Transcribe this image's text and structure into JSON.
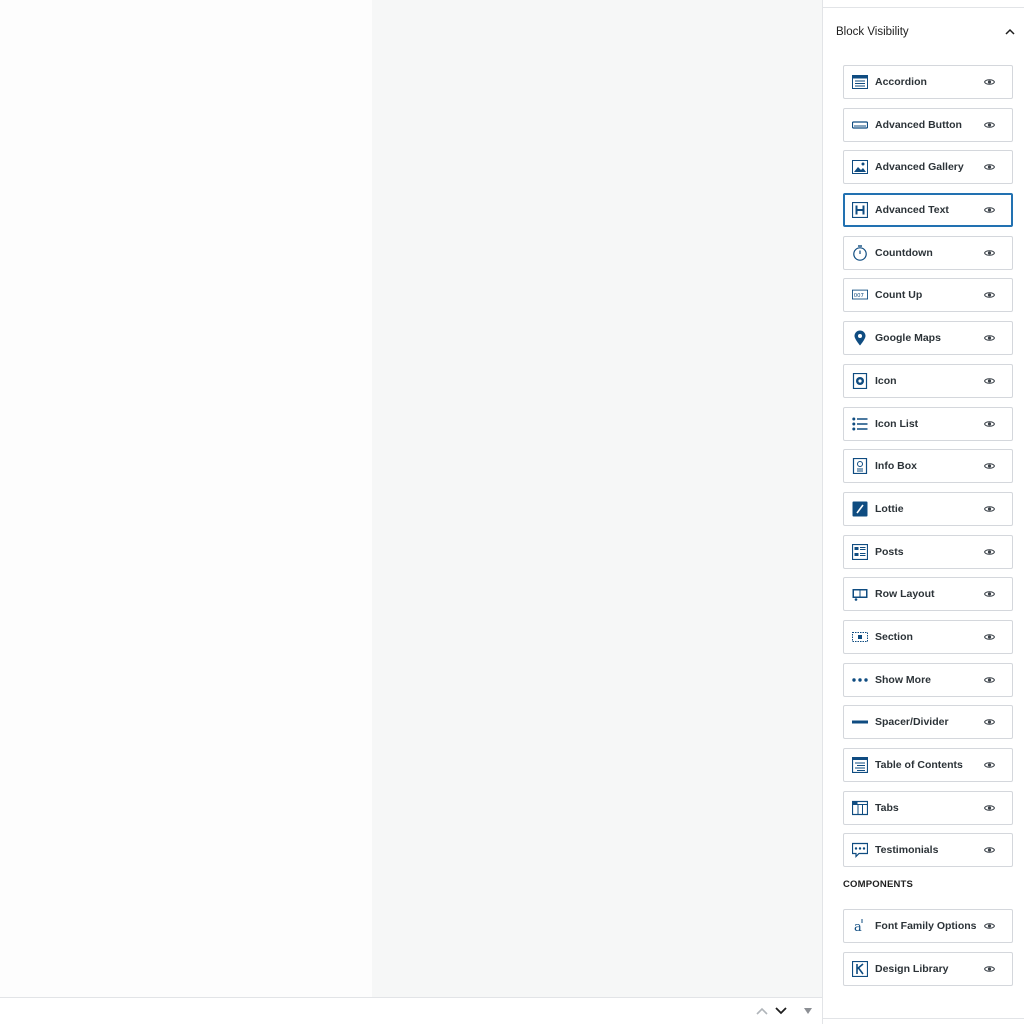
{
  "panel": {
    "title": "Block Visibility",
    "blocks": [
      {
        "label": "Accordion",
        "icon": "accordion-icon"
      },
      {
        "label": "Advanced Button",
        "icon": "button-icon"
      },
      {
        "label": "Advanced Gallery",
        "icon": "gallery-icon"
      },
      {
        "label": "Advanced Text",
        "icon": "heading-icon",
        "active": true
      },
      {
        "label": "Countdown",
        "icon": "stopwatch-icon"
      },
      {
        "label": "Count Up",
        "icon": "counter-icon"
      },
      {
        "label": "Google Maps",
        "icon": "map-pin-icon"
      },
      {
        "label": "Icon",
        "icon": "icon-block-icon"
      },
      {
        "label": "Icon List",
        "icon": "list-icon"
      },
      {
        "label": "Info Box",
        "icon": "info-box-icon"
      },
      {
        "label": "Lottie",
        "icon": "lottie-icon"
      },
      {
        "label": "Posts",
        "icon": "posts-icon"
      },
      {
        "label": "Row Layout",
        "icon": "row-layout-icon"
      },
      {
        "label": "Section",
        "icon": "section-icon"
      },
      {
        "label": "Show More",
        "icon": "dots-icon"
      },
      {
        "label": "Spacer/Divider",
        "icon": "divider-icon"
      },
      {
        "label": "Table of Contents",
        "icon": "toc-icon"
      },
      {
        "label": "Tabs",
        "icon": "tabs-icon"
      },
      {
        "label": "Testimonials",
        "icon": "testimonial-icon"
      }
    ],
    "components_heading": "COMPONENTS",
    "components": [
      {
        "label": "Font Family Options",
        "icon": "font-icon"
      },
      {
        "label": "Design Library",
        "icon": "design-library-icon"
      }
    ]
  },
  "colors": {
    "accent": "#2271b1",
    "icon_blue": "#0f4c81",
    "border": "#d4d7dc"
  }
}
